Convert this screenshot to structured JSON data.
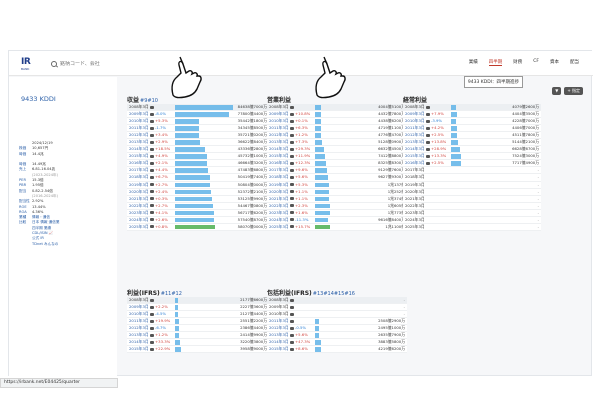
{
  "header": {
    "logo_text": "IR",
    "logo_sub": "BANK",
    "search_placeholder": "銘柄コード、会社",
    "nav": [
      {
        "label": "業績",
        "active": false
      },
      {
        "label": "四半期",
        "active": true
      },
      {
        "label": "財務",
        "active": false
      },
      {
        "label": "CF",
        "active": false
      },
      {
        "label": "資本",
        "active": false
      },
      {
        "label": "配当",
        "active": false
      }
    ],
    "tooltip": "9433 KDDI：四半期進捗",
    "tools": [
      "▼",
      "+ 指定"
    ]
  },
  "company": {
    "name": "9433 KDDI",
    "meta": [
      {
        "key": "",
        "value": "2024/12/19",
        "style": ""
      },
      {
        "key": "株価",
        "value": "10,657円",
        "style": ""
      },
      {
        "key": "時価",
        "value": "14.4兆",
        "style": ""
      },
      {
        "key": "",
        "value": "",
        "style": ""
      },
      {
        "key": "時価",
        "value": "14.49兆",
        "style": ""
      },
      {
        "key": "売上",
        "value": "6.81-16.04兆",
        "style": ""
      },
      {
        "key": "",
        "value": "(2023-2024年)",
        "style": "sub"
      },
      {
        "key": "PER",
        "value": "15.3倍",
        "style": ""
      },
      {
        "key": "PBR",
        "value": "1.95倍",
        "style": ""
      },
      {
        "key": "配当",
        "value": "0.82-2.54倍",
        "style": ""
      },
      {
        "key": "",
        "value": "(2016-2024年)",
        "style": "sub"
      },
      {
        "key": "配当性",
        "value": "2.92%",
        "style": ""
      },
      {
        "key": "ROE",
        "value": "13.44%",
        "style": ""
      },
      {
        "key": "ROA",
        "value": "4.36%",
        "style": ""
      },
      {
        "key": "業種",
        "value": "情報・通信",
        "style": "link"
      },
      {
        "key": "比較",
        "value": "日本 情報 通信業",
        "style": "link"
      },
      {
        "key": "",
        "value": "四半期 業績",
        "style": "link"
      },
      {
        "key": "",
        "value": "CDL/ISIN 📈",
        "style": "link"
      },
      {
        "key": "",
        "value": "公式 IR",
        "style": "link"
      },
      {
        "key": "",
        "value": "TDnet みんなの",
        "style": "link"
      }
    ]
  },
  "panels": [
    {
      "id": "revenue",
      "title": "収益",
      "anchor": "#9#10",
      "rows": [
        {
          "year": "2008年3月",
          "chg": "",
          "dir": "",
          "val": "84638億7000万",
          "bar": 0.62,
          "link": false
        },
        {
          "year": "2009年3月",
          "chg": "-8.0%",
          "dir": "down",
          "val": "77800億4400万",
          "bar": 0.57,
          "link": true
        },
        {
          "year": "2010年3月",
          "chg": "+5.3%",
          "dir": "up",
          "val": "35442億1800万",
          "bar": 0.26,
          "link": true
        },
        {
          "year": "2011年3月",
          "chg": "-1.7%",
          "dir": "down",
          "val": "34345億8500万",
          "bar": 0.25,
          "link": true
        },
        {
          "year": "2012年3月",
          "chg": "+3.4%",
          "dir": "up",
          "val": "35721億0200万",
          "bar": 0.26,
          "link": true
        },
        {
          "year": "2013年3月",
          "chg": "+2.9%",
          "dir": "up",
          "val": "36622億8400万",
          "bar": 0.27,
          "link": true
        },
        {
          "year": "2014年3月",
          "chg": "+18.5%",
          "dir": "up",
          "val": "43336億2800万",
          "bar": 0.32,
          "link": true
        },
        {
          "year": "2015年3月",
          "chg": "+4.9%",
          "dir": "up",
          "val": "45732億1000万",
          "bar": 0.34,
          "link": true
        },
        {
          "year": "2016年3月",
          "chg": "+2.1%",
          "dir": "up",
          "val": "46664億3200万",
          "bar": 0.34,
          "link": true
        },
        {
          "year": "2017年3月",
          "chg": "+4.4%",
          "dir": "up",
          "val": "47483億6800万",
          "bar": 0.35,
          "link": true
        },
        {
          "year": "2018年3月",
          "chg": "+6.7%",
          "dir": "up",
          "val": "50419億7400万",
          "bar": 0.37,
          "link": true
        },
        {
          "year": "2019年3月",
          "chg": "+2.7%",
          "dir": "up",
          "val": "50804億0000万",
          "bar": 0.37,
          "link": true
        },
        {
          "year": "2020年3月",
          "chg": "+2.4%",
          "dir": "up",
          "val": "52372億2100万",
          "bar": 0.38,
          "link": true
        },
        {
          "year": "2021年3月",
          "chg": "+0.3%",
          "dir": "up",
          "val": "53125億9900万",
          "bar": 0.39,
          "link": true
        },
        {
          "year": "2022年3月",
          "chg": "+2.7%",
          "dir": "up",
          "val": "54467億0800万",
          "bar": 0.4,
          "link": true
        },
        {
          "year": "2023年3月",
          "chg": "+4.1%",
          "dir": "up",
          "val": "56717億6200万",
          "bar": 0.42,
          "link": true
        },
        {
          "year": "2024年3月",
          "chg": "+2.6%",
          "dir": "up",
          "val": "57540億8700万",
          "bar": 0.42,
          "link": true
        },
        {
          "year": "2025年3月",
          "chg": "+0.8%",
          "dir": "up",
          "val": "58070億0000万",
          "bar": 0.43,
          "link": true,
          "green": true
        }
      ]
    },
    {
      "id": "operating",
      "title": "営業利益",
      "anchor": "",
      "rows": [
        {
          "year": "2008年3月",
          "chg": "",
          "dir": "",
          "val": "4004億5100万",
          "bar": 0.06,
          "link": false
        },
        {
          "year": "2009年3月",
          "chg": "+10.8%",
          "dir": "up",
          "val": "4432億7800万",
          "bar": 0.07,
          "link": true
        },
        {
          "year": "2010年3月",
          "chg": "+0.1%",
          "dir": "up",
          "val": "4438億6200万",
          "bar": 0.07,
          "link": true
        },
        {
          "year": "2011年3月",
          "chg": "+6.3%",
          "dir": "up",
          "val": "4719億1100万",
          "bar": 0.07,
          "link": true
        },
        {
          "year": "2012年3月",
          "chg": "+1.2%",
          "dir": "up",
          "val": "4776億4700万",
          "bar": 0.07,
          "link": true
        },
        {
          "year": "2013年3月",
          "chg": "+7.3%",
          "dir": "up",
          "val": "5128億0900万",
          "bar": 0.08,
          "link": true
        },
        {
          "year": "2014年3月",
          "chg": "+29.3%",
          "dir": "up",
          "val": "6632億4500万",
          "bar": 0.1,
          "link": true
        },
        {
          "year": "2015年3月",
          "chg": "+11.9%",
          "dir": "up",
          "val": "7412億8800万",
          "bar": 0.11,
          "link": true
        },
        {
          "year": "2016年3月",
          "chg": "+12.3%",
          "dir": "up",
          "val": "8325億8300万",
          "bar": 0.12,
          "link": true
        },
        {
          "year": "2017年3月",
          "chg": "+9.6%",
          "dir": "up",
          "val": "9129億7600万",
          "bar": 0.13,
          "link": true
        },
        {
          "year": "2018年3月",
          "chg": "+5.6%",
          "dir": "up",
          "val": "9627億9300万",
          "bar": 0.14,
          "link": true
        },
        {
          "year": "2019年3月",
          "chg": "+5.3%",
          "dir": "up",
          "val": "1兆137億",
          "bar": 0.15,
          "link": true
        },
        {
          "year": "2020年3月",
          "chg": "+1.1%",
          "dir": "up",
          "val": "1兆252億",
          "bar": 0.15,
          "link": true
        },
        {
          "year": "2021年3月",
          "chg": "+1.1%",
          "dir": "up",
          "val": "1兆374億",
          "bar": 0.15,
          "link": true
        },
        {
          "year": "2022年3月",
          "chg": "+2.3%",
          "dir": "up",
          "val": "1兆605億",
          "bar": 0.16,
          "link": true
        },
        {
          "year": "2023年3月",
          "chg": "+1.6%",
          "dir": "up",
          "val": "1兆773億",
          "bar": 0.16,
          "link": true
        },
        {
          "year": "2024年3月",
          "chg": "-11.3%",
          "dir": "down",
          "val": "9616億8400万",
          "bar": 0.14,
          "link": true
        },
        {
          "year": "2025年3月",
          "chg": "+15.7%",
          "dir": "up",
          "val": "1兆1100億",
          "bar": 0.16,
          "link": true,
          "green": true
        }
      ]
    },
    {
      "id": "ordinary",
      "title": "経常利益",
      "anchor": "",
      "rows": [
        {
          "year": "2008年3月",
          "chg": "",
          "dir": "",
          "val": "4079億2600万",
          "bar": 0.06,
          "link": false
        },
        {
          "year": "2009年3月",
          "chg": "+7.9%",
          "dir": "up",
          "val": "4404億3500万",
          "bar": 0.07,
          "link": true
        },
        {
          "year": "2010年3月",
          "chg": "-3.9%",
          "dir": "down",
          "val": "4228億7000万",
          "bar": 0.06,
          "link": true
        },
        {
          "year": "2011年3月",
          "chg": "+4.2%",
          "dir": "up",
          "val": "4406億7000万",
          "bar": 0.07,
          "link": true
        },
        {
          "year": "2012年3月",
          "chg": "+2.5%",
          "dir": "up",
          "val": "4511億7800万",
          "bar": 0.07,
          "link": true
        },
        {
          "year": "2013年3月",
          "chg": "+13.8%",
          "dir": "up",
          "val": "5144億2100万",
          "bar": 0.08,
          "link": true
        },
        {
          "year": "2014年3月",
          "chg": "+28.9%",
          "dir": "up",
          "val": "6628億6700万",
          "bar": 0.1,
          "link": true
        },
        {
          "year": "2015年3月",
          "chg": "+13.3%",
          "dir": "up",
          "val": "7524億3000万",
          "bar": 0.11,
          "link": true
        },
        {
          "year": "2016年3月",
          "chg": "+2.5%",
          "dir": "up",
          "val": "7717億4900万",
          "bar": 0.11,
          "link": true
        },
        {
          "year": "2017年3月",
          "chg": "",
          "dir": "",
          "val": "-",
          "bar": 0,
          "link": false,
          "empty": true
        },
        {
          "year": "2018年3月",
          "chg": "",
          "dir": "",
          "val": "-",
          "bar": 0,
          "link": false,
          "empty": true
        },
        {
          "year": "2019年3月",
          "chg": "",
          "dir": "",
          "val": "-",
          "bar": 0,
          "link": false,
          "empty": true
        },
        {
          "year": "2020年3月",
          "chg": "",
          "dir": "",
          "val": "-",
          "bar": 0,
          "link": false,
          "empty": true
        },
        {
          "year": "2021年3月",
          "chg": "",
          "dir": "",
          "val": "-",
          "bar": 0,
          "link": false,
          "empty": true
        },
        {
          "year": "2022年3月",
          "chg": "",
          "dir": "",
          "val": "-",
          "bar": 0,
          "link": false,
          "empty": true
        },
        {
          "year": "2023年3月",
          "chg": "",
          "dir": "",
          "val": "-",
          "bar": 0,
          "link": false,
          "empty": true
        },
        {
          "year": "2024年3月",
          "chg": "",
          "dir": "",
          "val": "-",
          "bar": 0,
          "link": false,
          "empty": true
        },
        {
          "year": "2025年3月",
          "chg": "",
          "dir": "",
          "val": "-",
          "bar": 0,
          "link": false,
          "empty": true
        }
      ]
    },
    {
      "id": "net-ifrs",
      "title": "利益(IFRS)",
      "anchor": "#11#12",
      "rows": [
        {
          "year": "2008年3月",
          "chg": "",
          "dir": "",
          "val": "2177億6600万",
          "bar": 0.03,
          "link": false
        },
        {
          "year": "2009年3月",
          "chg": "+2.2%",
          "dir": "up",
          "val": "2227億3600万",
          "bar": 0.03,
          "link": true
        },
        {
          "year": "2010年3月",
          "chg": "-4.5%",
          "dir": "down",
          "val": "2127億4400万",
          "bar": 0.03,
          "link": true
        },
        {
          "year": "2011年3月",
          "chg": "+19.9%",
          "dir": "up",
          "val": "2551億2200万",
          "bar": 0.04,
          "link": true
        },
        {
          "year": "2012年3月",
          "chg": "-6.7%",
          "dir": "down",
          "val": "2386億4400万",
          "bar": 0.04,
          "link": true
        },
        {
          "year": "2013年3月",
          "chg": "+1.2%",
          "dir": "up",
          "val": "2414億9900万",
          "bar": 0.04,
          "link": true
        },
        {
          "year": "2014年3月",
          "chg": "+33.3%",
          "dir": "up",
          "val": "3220億3800万",
          "bar": 0.05,
          "link": true
        },
        {
          "year": "2015年3月",
          "chg": "+22.9%",
          "dir": "up",
          "val": "3958億9000万",
          "bar": 0.06,
          "link": true
        }
      ]
    },
    {
      "id": "comprehensive-ifrs",
      "title": "包括利益(IFRS)",
      "anchor": "#13#14#15#16",
      "rows": [
        {
          "year": "2008年3月",
          "chg": "",
          "dir": "",
          "val": "-",
          "bar": 0,
          "link": false,
          "empty": true
        },
        {
          "year": "2009年3月",
          "chg": "",
          "dir": "",
          "val": "-",
          "bar": 0,
          "link": false,
          "empty": true
        },
        {
          "year": "2010年3月",
          "chg": "",
          "dir": "",
          "val": "-",
          "bar": 0,
          "link": false,
          "empty": true
        },
        {
          "year": "2011年3月",
          "chg": "",
          "dir": "",
          "val": "2508億2900万",
          "bar": 0.04,
          "link": true
        },
        {
          "year": "2012年3月",
          "chg": "-0.5%",
          "dir": "down",
          "val": "2495億1000万",
          "bar": 0.04,
          "link": true
        },
        {
          "year": "2013年3月",
          "chg": "+5.6%",
          "dir": "up",
          "val": "2635億7900万",
          "bar": 0.04,
          "link": true
        },
        {
          "year": "2014年3月",
          "chg": "+47.3%",
          "dir": "up",
          "val": "3883億5800万",
          "bar": 0.06,
          "link": true
        },
        {
          "year": "2015年3月",
          "chg": "+8.6%",
          "dir": "up",
          "val": "4219億6200万",
          "bar": 0.06,
          "link": true
        }
      ]
    }
  ],
  "statusbar": {
    "url": "https://irbank.net/E04425/quarter"
  }
}
